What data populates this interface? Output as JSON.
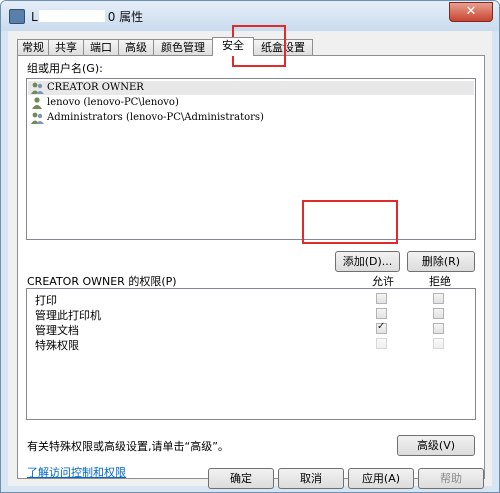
{
  "window": {
    "title_prefix": "L",
    "title_suffix": "0 属性",
    "close_symbol": "✕"
  },
  "tabs": [
    {
      "label": "常规"
    },
    {
      "label": "共享"
    },
    {
      "label": "端口"
    },
    {
      "label": "高级"
    },
    {
      "label": "颜色管理"
    },
    {
      "label": "安全"
    },
    {
      "label": "纸盒设置"
    }
  ],
  "active_tab": "安全",
  "security": {
    "groups_label": "组或用户名(G):",
    "users": [
      {
        "name": "CREATOR OWNER",
        "icon": "users-group-icon"
      },
      {
        "name": "lenovo (lenovo-PC\\lenovo)",
        "icon": "user-icon"
      },
      {
        "name": "Administrators (lenovo-PC\\Administrators)",
        "icon": "users-group-icon"
      }
    ],
    "add_button": "添加(D)...",
    "remove_button": "删除(R)",
    "permissions_label": "CREATOR OWNER 的权限(P)",
    "allow_header": "允许",
    "deny_header": "拒绝",
    "permissions": [
      {
        "name": "打印",
        "allow": false,
        "deny": false,
        "disabled": false
      },
      {
        "name": "管理此打印机",
        "allow": false,
        "deny": false,
        "disabled": false
      },
      {
        "name": "管理文档",
        "allow": true,
        "deny": false,
        "disabled": false
      },
      {
        "name": "特殊权限",
        "allow": false,
        "deny": false,
        "disabled": true
      }
    ],
    "advanced_hint": "有关特殊权限或高级设置,请单击“高级”。",
    "advanced_button": "高级(V)",
    "learn_link": "了解访问控制和权限"
  },
  "footer": {
    "ok": "确定",
    "cancel": "取消",
    "apply": "应用(A)",
    "help": "帮助"
  },
  "colors": {
    "highlight_box": "#e02b2b",
    "link": "#0066cc"
  }
}
